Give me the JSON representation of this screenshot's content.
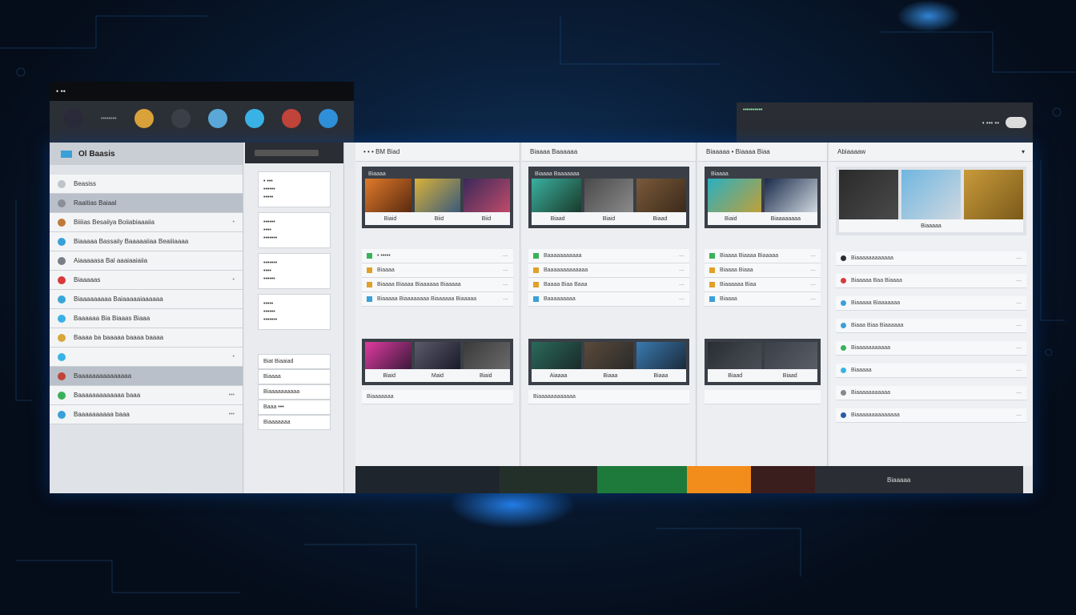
{
  "toolbar_window": {
    "title": "• ••",
    "label": "••••••••",
    "icons": [
      {
        "name": "record-icon",
        "color": "#2a2a3a"
      },
      {
        "name": "color-wheel-icon",
        "color": "#d9a23a"
      },
      {
        "name": "window-icon",
        "color": "#3b4048"
      },
      {
        "name": "globe-icon",
        "color": "#5aa7d8"
      },
      {
        "name": "chat-icon",
        "color": "#39b3e6"
      },
      {
        "name": "swirl-icon",
        "color": "#c0443a"
      },
      {
        "name": "refresh-icon",
        "color": "#2f8fd8"
      }
    ]
  },
  "top_strip": {
    "title": "••••••••••",
    "right_label": "• ••• ••"
  },
  "sidebar": {
    "header": "Ol Baasis",
    "items": [
      {
        "label": "Beasiss",
        "meta": "",
        "color": "#bfc4cb"
      },
      {
        "label": "Raaitias Baiaal",
        "meta": "",
        "color": "#8a8f97"
      },
      {
        "label": "Biiiias Besaiiya Boiiabiaaaiia",
        "meta": "•",
        "color": "#c07a3a"
      },
      {
        "label": "Biaaaaa Bassaiiy Baaaaaiiaa Beaiiiaaaa",
        "meta": "",
        "color": "#3aa0d8"
      },
      {
        "label": "Aiaaaaasa Bal aaaiaaiaiia",
        "meta": "",
        "color": "#7a7f87"
      },
      {
        "label": "Biaaaaas",
        "meta": "•",
        "color": "#d83a3a"
      },
      {
        "label": "Biaaaaaaaaa Baiaaaaaiaaaaaa",
        "meta": "",
        "color": "#39a6d8"
      },
      {
        "label": "Baaaaaa Bia Biaaas Biaaa",
        "meta": "",
        "color": "#3ab0e6"
      },
      {
        "label": "Baaaa ba baaaaa baaaa baaaa",
        "meta": "",
        "color": "#d8a63a"
      },
      {
        "label": "",
        "meta": "•",
        "color": "#39b3e6"
      },
      {
        "label": "Baaaaaaaaaaaaaaa",
        "meta": "",
        "color": "#c0443a"
      },
      {
        "label": "Baaaaaaaaaaaaa baaa",
        "meta": "•••",
        "color": "#3ab05a"
      },
      {
        "label": "Baaaaaaaaaa baaa",
        "meta": "•••",
        "color": "#3aa0d8"
      }
    ]
  },
  "col2": {
    "cards": [
      {
        "lines": [
          "• •••",
          "••••••",
          "•••••"
        ]
      },
      {
        "lines": [
          "••••••",
          "••••",
          "•••••••"
        ]
      },
      {
        "lines": [
          "•••••••",
          "••••",
          "••••••"
        ]
      },
      {
        "lines": [
          "•••••",
          "••••••",
          "•••••••"
        ]
      }
    ],
    "bottom": [
      "Biat Biaaiad",
      "Biaaaa",
      "Biaaaaaaaaaa",
      "Baaa •••",
      "Biaaaaaaa"
    ]
  },
  "panels": [
    {
      "header": "• • • BM Biad",
      "gallery_title": "Biaaaa",
      "thumb_labels": [
        "Biaid",
        "Biid",
        "Biid"
      ],
      "rows": [
        "• •••••",
        "Biaaaa",
        "Biaaaa Biaaaa Biaaaaaa Biaaaaa",
        "Biaaaaa Biaaaaaaaa Biaaaaaa Biaaaaa"
      ],
      "gallery2_labels": [
        "Biaid",
        "Maid",
        "Biaid"
      ],
      "footer": "Biaaaaaaa"
    },
    {
      "header": "Biaaaa  Baaaaaa",
      "gallery_title": "Biaaaa  Baaaaaaa",
      "thumb_labels": [
        "Biaad",
        "Biaid",
        "Biaad"
      ],
      "rows": [
        "Baaaaaaaaaaa",
        "Baaaaaaaaaaaaa",
        "Baaaa Biaa Baaa",
        "Baaaaaaaaa"
      ],
      "gallery2_labels": [
        "Aiaaaa",
        "Biaaa",
        "Biaaa"
      ],
      "footer": "Biaaaaaaaaaaaa"
    },
    {
      "header": "Biaaaaa • Biaaaa Biaa",
      "gallery_title": "Biaaaa",
      "thumb_labels": [
        "Biaid",
        "Biaaaaaaaa"
      ],
      "rows": [
        "Biaaaa Biaaaa Biaaaaa",
        "Biaaaa  Biaaa",
        "Biaaaaaa  Biaa",
        "Biaaaa"
      ],
      "gallery2_labels": [
        "Biaad",
        "Biaad"
      ],
      "footer": ""
    }
  ],
  "right_panel": {
    "header": "Abiaaaaw",
    "gallery_label": "Biaaaaa",
    "rows": [
      "Biaaaaaaaaaaaa",
      "Biaaaaa Baa Biaaaa",
      "Biaaaaa Biaaaaaaa",
      "Biaaa Biaa Biaaaaaa",
      "Biaaaaaaaaaaa",
      "Biaaaaa",
      "Biaaaaaaaaaaa",
      "Biaaaaaaaaaaaaaa"
    ]
  },
  "bottom_bar": {
    "label": "Biaaaaa",
    "colors": [
      "#1f252d",
      "#23302a",
      "#1d7a3a",
      "#f28c1a",
      "#3a1e1e",
      "#2a2d33"
    ]
  }
}
